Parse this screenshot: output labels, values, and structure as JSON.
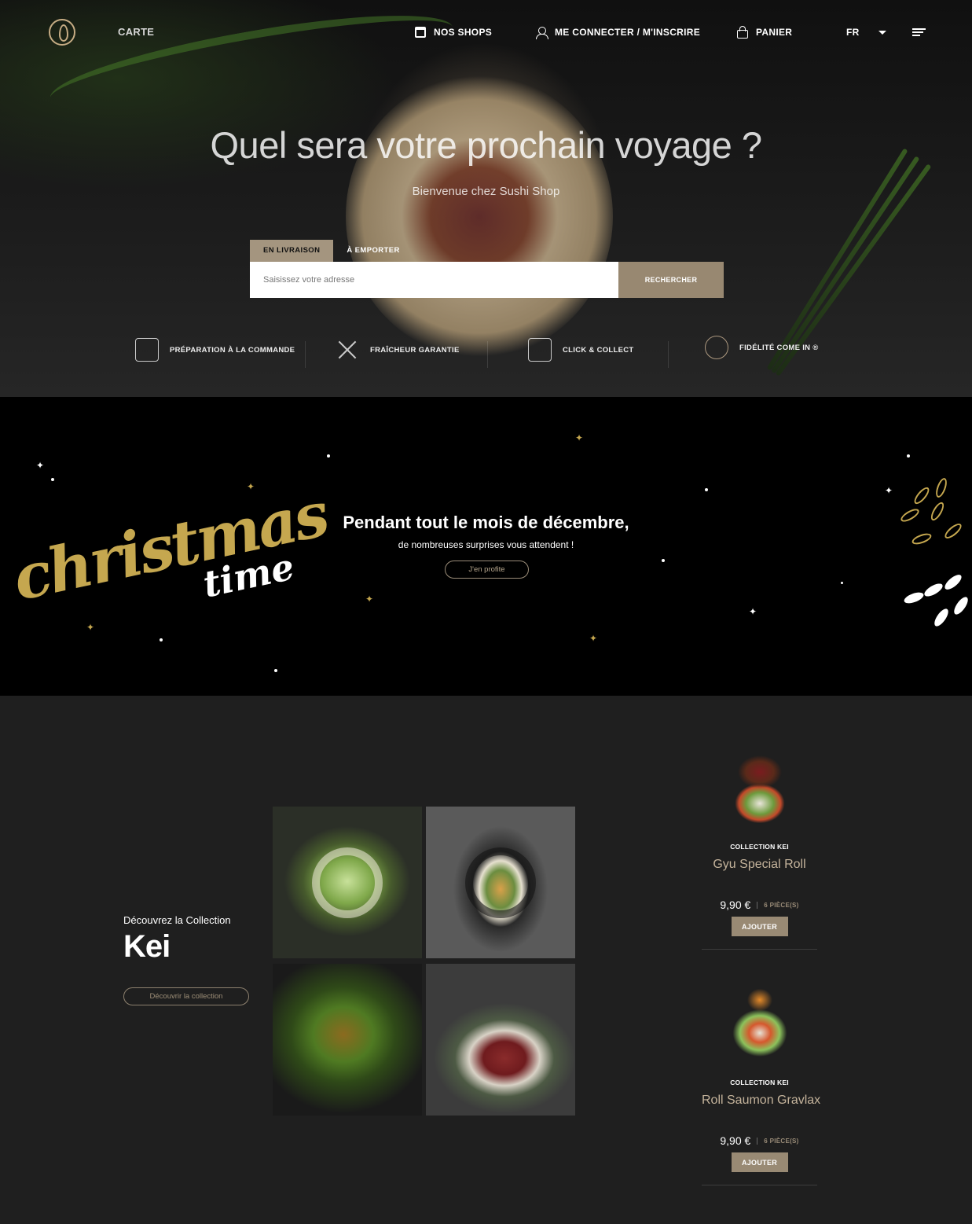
{
  "nav": {
    "carte": "CARTE",
    "shops": "NOS SHOPS",
    "login": "ME CONNECTER / M'INSCRIRE",
    "cart": "PANIER",
    "lang": "FR"
  },
  "hero": {
    "title": "Quel sera votre prochain voyage ?",
    "subtitle": "Bienvenue chez Sushi Shop",
    "tabs": [
      "EN LIVRAISON",
      "À EMPORTER"
    ],
    "search_placeholder": "Saisissez votre adresse",
    "search_button": "RECHERCHER"
  },
  "features": [
    {
      "label": "PRÉPARATION À LA COMMANDE",
      "icon": "chef-hat-icon"
    },
    {
      "label": "FRAÎCHEUR GARANTIE",
      "icon": "knives-icon"
    },
    {
      "label": "CLICK & COLLECT",
      "icon": "shop-icon"
    },
    {
      "label": "FIDÉLITÉ COME IN ®",
      "icon": "loyalty-logo-icon"
    }
  ],
  "christmas": {
    "script_word": "christmas",
    "script_word_2": "time",
    "headline": "Pendant tout le mois de décembre,",
    "subline": "de nombreuses surprises vous attendent !",
    "button": "J'en profite"
  },
  "collection": {
    "pre": "Découvrez la Collection",
    "name": "Kei",
    "button": "Découvrir la collection"
  },
  "products": [
    {
      "collection": "COLLECTION KEI",
      "name": "Gyu Special Roll",
      "price": "9,90 €",
      "pieces": "6 PIÈCE(S)",
      "add": "AJOUTER"
    },
    {
      "collection": "COLLECTION KEI",
      "name": "Roll Saumon Gravlax",
      "price": "9,90 €",
      "pieces": "6 PIÈCE(S)",
      "add": "AJOUTER"
    }
  ],
  "colors": {
    "accent": "#a4957f",
    "gold": "#c5a74f"
  }
}
